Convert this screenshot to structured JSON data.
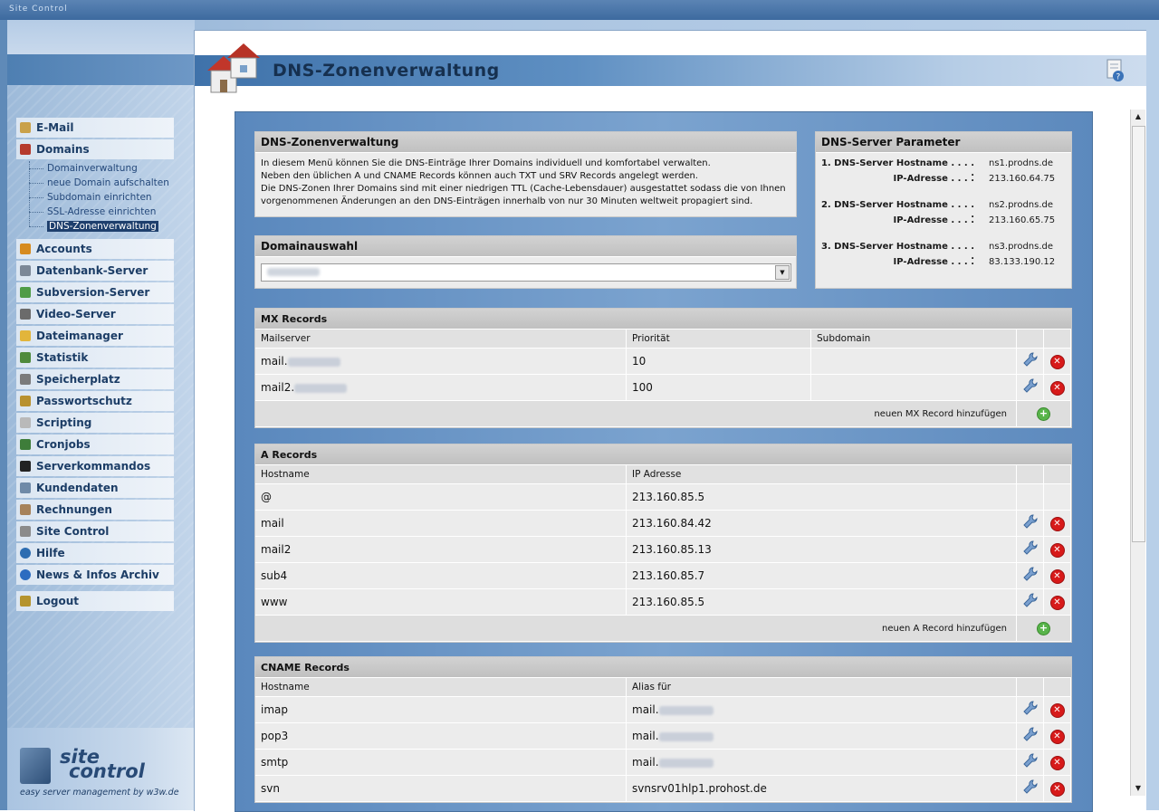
{
  "window": {
    "title": "Site Control"
  },
  "sidebar": {
    "menu": [
      {
        "label": "E-Mail",
        "icon": "email-icon",
        "color": "#c9a14a"
      },
      {
        "label": "Domains",
        "icon": "domains-icon",
        "color": "#b53a2c"
      },
      {
        "label": "Accounts",
        "icon": "accounts-icon",
        "color": "#d68b20"
      },
      {
        "label": "Datenbank-Server",
        "icon": "database-icon",
        "color": "#7c8897"
      },
      {
        "label": "Subversion-Server",
        "icon": "subversion-icon",
        "color": "#4f9c47"
      },
      {
        "label": "Video-Server",
        "icon": "video-icon",
        "color": "#6b6b6b"
      },
      {
        "label": "Dateimanager",
        "icon": "folder-icon",
        "color": "#e2b53b"
      },
      {
        "label": "Statistik",
        "icon": "statistics-icon",
        "color": "#4f8a3c"
      },
      {
        "label": "Speicherplatz",
        "icon": "storage-icon",
        "color": "#7b7b7b"
      },
      {
        "label": "Passwortschutz",
        "icon": "lock-icon",
        "color": "#b8912f"
      },
      {
        "label": "Scripting",
        "icon": "script-icon",
        "color": "#b9b9b9"
      },
      {
        "label": "Cronjobs",
        "icon": "clock-icon",
        "color": "#3e7d3a"
      },
      {
        "label": "Serverkommandos",
        "icon": "terminal-icon",
        "color": "#222222"
      },
      {
        "label": "Kundendaten",
        "icon": "customer-icon",
        "color": "#6f8aa8"
      },
      {
        "label": "Rechnungen",
        "icon": "invoice-icon",
        "color": "#a6825a"
      },
      {
        "label": "Site Control",
        "icon": "site-control-icon",
        "color": "#8b8b8b"
      },
      {
        "label": "Hilfe",
        "icon": "help-icon",
        "color": "#2d6db1"
      },
      {
        "label": "News & Infos Archiv",
        "icon": "news-icon",
        "color": "#2c6cc0"
      }
    ],
    "domains_sub": [
      {
        "label": "Domainverwaltung"
      },
      {
        "label": "neue Domain aufschalten"
      },
      {
        "label": "Subdomain einrichten"
      },
      {
        "label": "SSL-Adresse einrichten"
      },
      {
        "label": "DNS-Zonenverwaltung"
      }
    ],
    "logout": {
      "label": "Logout",
      "icon": "logout-icon",
      "color": "#b5942e"
    },
    "logo": {
      "line1": "site",
      "line2": "control",
      "tagline": "easy server management by w3w.de"
    }
  },
  "header": {
    "title": "DNS-Zonenverwaltung"
  },
  "intro": {
    "title": "DNS-Zonenverwaltung",
    "lines": [
      "In diesem Menü können Sie die DNS-Einträge Ihrer Domains individuell und komfortabel verwalten.",
      "Neben den üblichen A und CNAME Records können auch TXT und SRV Records angelegt werden.",
      "Die DNS-Zonen Ihrer Domains sind mit einer niedrigen TTL (Cache-Lebensdauer) ausgestattet sodass die von Ihnen",
      "vorgenommenen Änderungen an den DNS-Einträgen innerhalb von nur 30 Minuten weltweit propagiert sind."
    ]
  },
  "domainauswahl": {
    "title": "Domainauswahl"
  },
  "dns_params": {
    "title": "DNS-Server Parameter",
    "servers": [
      {
        "hostname_label": "1. DNS-Server Hostname . . . . .",
        "hostname": "ns1.prodns.de",
        "ip_label": "IP-Adresse . . . .",
        "ip": "213.160.64.75"
      },
      {
        "hostname_label": "2. DNS-Server Hostname . . . . .",
        "hostname": "ns2.prodns.de",
        "ip_label": "IP-Adresse . . . .",
        "ip": "213.160.65.75"
      },
      {
        "hostname_label": "3. DNS-Server Hostname . . . . .",
        "hostname": "ns3.prodns.de",
        "ip_label": "IP-Adresse . . . .",
        "ip": "83.133.190.12"
      }
    ]
  },
  "mx": {
    "title": "MX Records",
    "columns": [
      "Mailserver",
      "Priorität",
      "Subdomain"
    ],
    "rows": [
      {
        "mailserver": "mail.",
        "priority": "10",
        "subdomain": ""
      },
      {
        "mailserver": "mail2.",
        "priority": "100",
        "subdomain": ""
      }
    ],
    "add_label": "neuen MX Record hinzufügen"
  },
  "a": {
    "title": "A Records",
    "columns": [
      "Hostname",
      "IP Adresse"
    ],
    "rows": [
      {
        "host": "@",
        "ip": "213.160.85.5",
        "editable": false
      },
      {
        "host": "mail",
        "ip": "213.160.84.42",
        "editable": true
      },
      {
        "host": "mail2",
        "ip": "213.160.85.13",
        "editable": true
      },
      {
        "host": "sub4",
        "ip": "213.160.85.7",
        "editable": true
      },
      {
        "host": "www",
        "ip": "213.160.85.5",
        "editable": true
      }
    ],
    "add_label": "neuen A Record hinzufügen"
  },
  "cname": {
    "title": "CNAME Records",
    "columns": [
      "Hostname",
      "Alias für"
    ],
    "rows": [
      {
        "host": "imap",
        "alias": "mail."
      },
      {
        "host": "pop3",
        "alias": "mail."
      },
      {
        "host": "smtp",
        "alias": "mail."
      },
      {
        "host": "svn",
        "alias": "svnsrv01hlp1.prohost.de"
      }
    ]
  }
}
